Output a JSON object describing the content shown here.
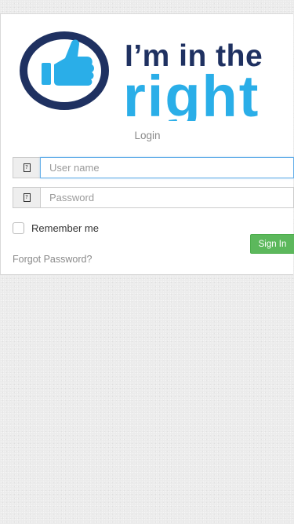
{
  "logo": {
    "line1": "I’m in the",
    "line2": "right",
    "colors": {
      "navy": "#1f3161",
      "blue": "#2aaee8"
    }
  },
  "login": {
    "heading": "Login",
    "username": {
      "placeholder": "User name",
      "value": "",
      "icon": "user-icon"
    },
    "password": {
      "placeholder": "Password",
      "value": "",
      "icon": "lock-icon"
    },
    "remember_label": "Remember me",
    "signin_label": "Sign In",
    "forgot_label": "Forgot Password?"
  },
  "colors": {
    "signin_bg": "#5cb85c",
    "focus_border": "#66afe9",
    "page_bg": "#ebebeb"
  }
}
